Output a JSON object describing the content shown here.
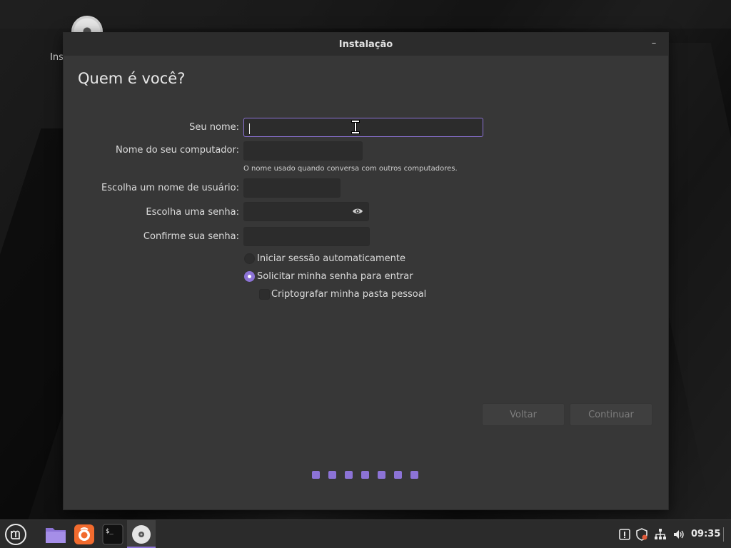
{
  "desktop": {
    "icon_label": "Ins"
  },
  "window": {
    "title": "Instalação",
    "minimize_glyph": "–",
    "heading": "Quem é você?"
  },
  "form": {
    "name_label": "Seu nome:",
    "name_value": "",
    "computer_label": "Nome do seu computador:",
    "computer_value": "",
    "computer_hint": "O nome usado quando conversa com outros computadores.",
    "username_label": "Escolha um nome de usuário:",
    "username_value": "",
    "password_label": "Escolha uma senha:",
    "password_value": "",
    "confirm_label": "Confirme sua senha:",
    "confirm_value": ""
  },
  "options": {
    "autologin_label": "Iniciar sessão automaticamente",
    "autologin_checked": false,
    "require_password_label": "Solicitar minha senha para entrar",
    "require_password_checked": true,
    "encrypt_home_label": "Criptografar minha pasta pessoal",
    "encrypt_home_checked": false
  },
  "buttons": {
    "back": "Voltar",
    "continue": "Continuar"
  },
  "progress": {
    "steps_total": 7
  },
  "taskbar": {
    "clock": "09:35",
    "apps": [
      "menu-icon",
      "files-icon",
      "firefox-icon",
      "terminal-icon",
      "installer-disc-icon"
    ],
    "tray": [
      "notification-icon",
      "shield-update-icon",
      "network-icon",
      "volume-icon"
    ]
  },
  "colors": {
    "accent": "#8c73d6",
    "window_bg": "#373737",
    "titlebar_bg": "#2c2c2c",
    "field_bg": "#2c2c2c",
    "taskbar_bg": "#2b2b2b"
  }
}
